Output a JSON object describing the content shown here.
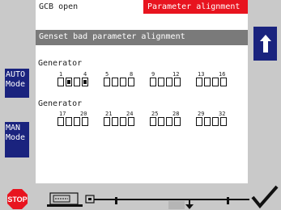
{
  "header": {
    "breaker_status": "GCB open",
    "alarm_title": "Parameter alignment"
  },
  "message": "Genset bad parameter alignment",
  "softkeys": {
    "auto": {
      "line1": "AUTO",
      "line2": "Mode"
    },
    "man": {
      "line1": "MAN",
      "line2": "Mode"
    }
  },
  "section1": {
    "label": "Generator",
    "numbers": [
      "1",
      "4",
      "5",
      "8",
      "9",
      "12",
      "13",
      "16"
    ],
    "states": [
      0,
      1,
      0,
      1,
      0,
      0,
      0,
      0,
      0,
      0,
      0,
      0,
      0,
      0,
      0,
      0
    ]
  },
  "section2": {
    "label": "Generator",
    "numbers": [
      "17",
      "20",
      "21",
      "24",
      "25",
      "28",
      "29",
      "32"
    ],
    "states": [
      0,
      0,
      0,
      0,
      0,
      0,
      0,
      0,
      0,
      0,
      0,
      0,
      0,
      0,
      0,
      0
    ]
  },
  "bottom": {
    "stop_label": "STOP"
  },
  "colors": {
    "alarm_red": "#e8141f",
    "softkey_blue": "#1a237e",
    "message_gray": "#7a7a7a",
    "panel_gray": "#c9c9c9"
  }
}
